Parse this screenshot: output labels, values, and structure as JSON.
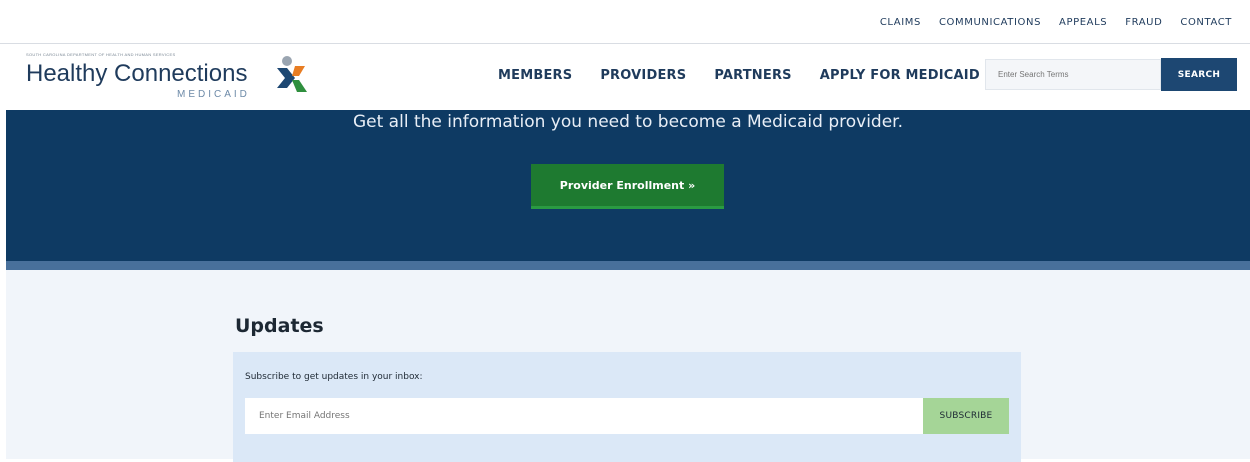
{
  "utility_nav": [
    "CLAIMS",
    "COMMUNICATIONS",
    "APPEALS",
    "FRAUD",
    "CONTACT"
  ],
  "logo": {
    "department": "SOUTH CAROLINA DEPARTMENT OF HEALTH AND HUMAN SERVICES",
    "name": "Healthy Connections",
    "sub": "MEDICAID"
  },
  "main_nav": [
    "MEMBERS",
    "PROVIDERS",
    "PARTNERS",
    "APPLY FOR MEDICAID"
  ],
  "search": {
    "placeholder": "Enter Search Terms",
    "button_label": "SEARCH"
  },
  "hero": {
    "text": "Get all the information you need to become a Medicaid provider.",
    "button_label": "Provider Enrollment »"
  },
  "updates": {
    "title": "Updates",
    "subscribe_label": "Subscribe to get updates in your inbox:",
    "email_placeholder": "Enter Email Address",
    "subscribe_button": "SUBSCRIBE"
  },
  "colors": {
    "navy": "#0e3a63",
    "nav_text": "#1f3b5c",
    "green_button": "#1e7a30",
    "subscribe_green": "#a5d597",
    "light_blue_bg": "#dbe8f7",
    "logo_orange": "#e87d23",
    "logo_green": "#2f8f3e",
    "logo_blue": "#1d4772",
    "logo_gray": "#9aa5b1"
  }
}
